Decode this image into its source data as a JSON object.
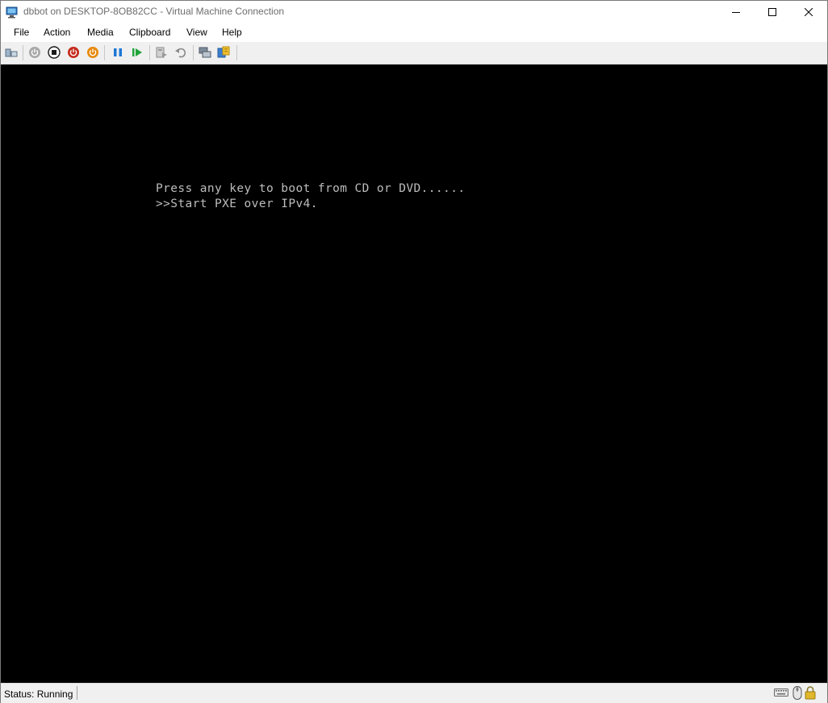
{
  "window": {
    "title": "dbbot on DESKTOP-8OB82CC - Virtual Machine Connection",
    "app_icon": "vm-connection-icon",
    "caption_buttons": [
      "minimize-icon",
      "maximize-icon",
      "close-icon"
    ]
  },
  "menu": {
    "items": [
      "File",
      "Action",
      "Media",
      "Clipboard",
      "View",
      "Help"
    ]
  },
  "toolbar": {
    "buttons": [
      "ctrl-alt-del-icon",
      "start-icon",
      "turn-off-icon",
      "shut-down-icon",
      "save-icon",
      "pause-icon",
      "resume-icon",
      "checkpoint-icon",
      "revert-icon",
      "enhanced-session-icon",
      "share-icon"
    ]
  },
  "console": {
    "lines": [
      "Press any key to boot from CD or DVD......",
      ">>Start PXE over IPv4."
    ],
    "text_color": "#bdbdbd",
    "background": "#000000"
  },
  "status": {
    "text": "Status: Running",
    "icons": [
      "keyboard-icon",
      "mouse-icon",
      "lock-icon"
    ]
  },
  "colors": {
    "stop_red": "#c42b1c",
    "save_orange": "#e8890c",
    "pause_blue": "#1e78d6",
    "resume_green": "#22a33b"
  }
}
